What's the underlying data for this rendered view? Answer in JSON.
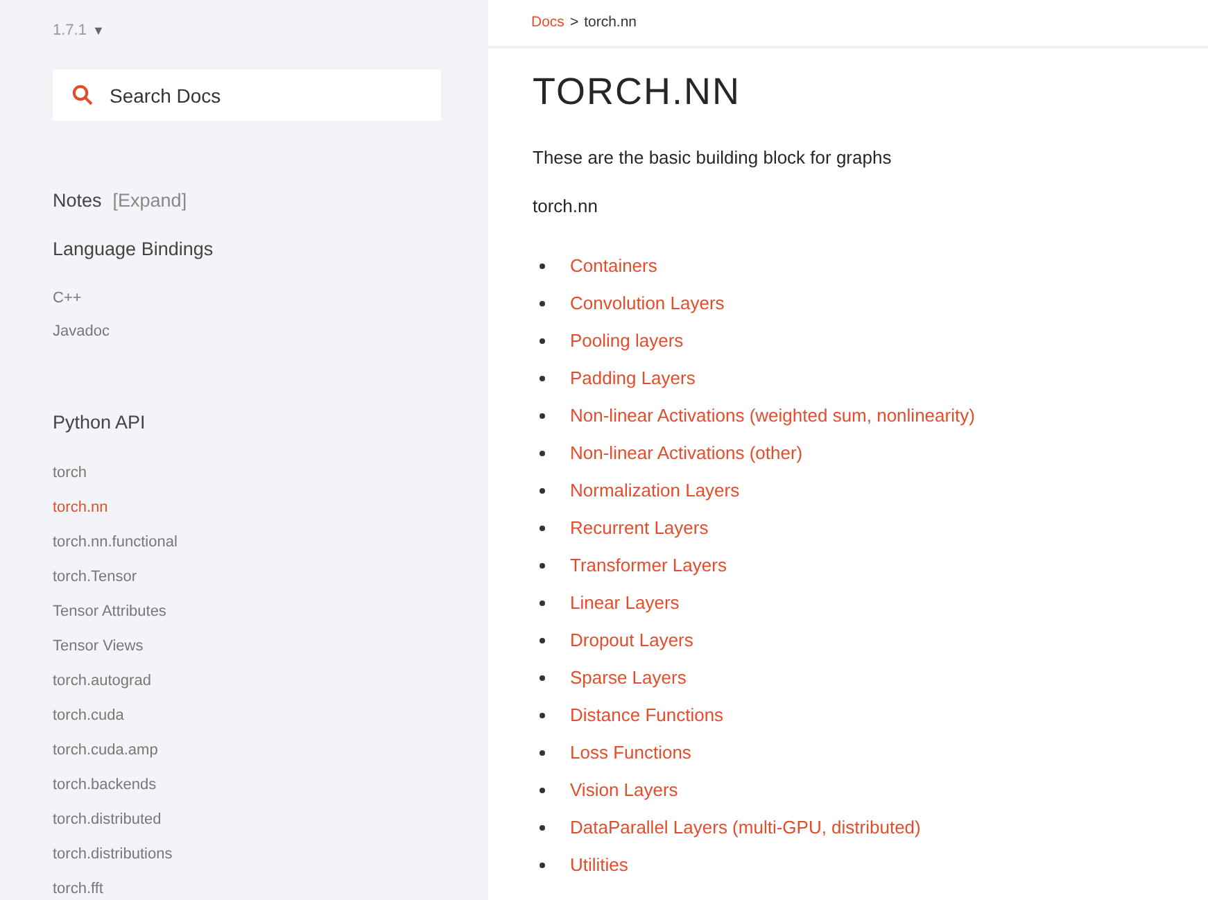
{
  "sidebar": {
    "version": "1.7.1",
    "version_caret": "▼",
    "search": {
      "placeholder": "Search Docs"
    },
    "notes": {
      "label": "Notes",
      "toggle": "[Expand]"
    },
    "sections": [
      {
        "title": "Language Bindings",
        "items": [
          {
            "label": "C++",
            "selected": false
          },
          {
            "label": "Javadoc",
            "selected": false
          }
        ]
      },
      {
        "title": "Python API",
        "items": [
          {
            "label": "torch",
            "selected": false
          },
          {
            "label": "torch.nn",
            "selected": true
          },
          {
            "label": "torch.nn.functional",
            "selected": false
          },
          {
            "label": "torch.Tensor",
            "selected": false
          },
          {
            "label": "Tensor Attributes",
            "selected": false
          },
          {
            "label": "Tensor Views",
            "selected": false
          },
          {
            "label": "torch.autograd",
            "selected": false
          },
          {
            "label": "torch.cuda",
            "selected": false
          },
          {
            "label": "torch.cuda.amp",
            "selected": false
          },
          {
            "label": "torch.backends",
            "selected": false
          },
          {
            "label": "torch.distributed",
            "selected": false
          },
          {
            "label": "torch.distributions",
            "selected": false
          },
          {
            "label": "torch.fft",
            "selected": false
          }
        ]
      }
    ]
  },
  "breadcrumb": {
    "link": "Docs",
    "separator": ">",
    "current": "torch.nn"
  },
  "title": "TORCH.NN",
  "intro": "These are the basic building block for graphs",
  "module": "torch.nn",
  "links": [
    "Containers",
    "Convolution Layers",
    "Pooling layers",
    "Padding Layers",
    "Non-linear Activations (weighted sum, nonlinearity)",
    "Non-linear Activations (other)",
    "Normalization Layers",
    "Recurrent Layers",
    "Transformer Layers",
    "Linear Layers",
    "Dropout Layers",
    "Sparse Layers",
    "Distance Functions",
    "Loss Functions",
    "Vision Layers",
    "DataParallel Layers (multi-GPU, distributed)",
    "Utilities"
  ]
}
